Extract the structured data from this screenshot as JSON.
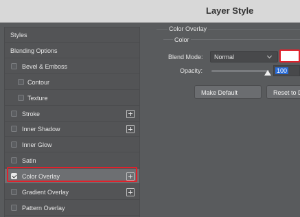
{
  "window": {
    "title": "Layer Style"
  },
  "sidebar": {
    "items": [
      {
        "label": "Styles",
        "checkbox": false,
        "plus": false,
        "checked": false
      },
      {
        "label": "Blending Options",
        "checkbox": false,
        "plus": false,
        "checked": false
      },
      {
        "label": "Bevel & Emboss",
        "checkbox": true,
        "plus": false,
        "checked": false
      },
      {
        "label": "Contour",
        "checkbox": true,
        "plus": false,
        "checked": false
      },
      {
        "label": "Texture",
        "checkbox": true,
        "plus": false,
        "checked": false
      },
      {
        "label": "Stroke",
        "checkbox": true,
        "plus": true,
        "checked": false
      },
      {
        "label": "Inner Shadow",
        "checkbox": true,
        "plus": true,
        "checked": false
      },
      {
        "label": "Inner Glow",
        "checkbox": true,
        "plus": false,
        "checked": false
      },
      {
        "label": "Satin",
        "checkbox": true,
        "plus": false,
        "checked": false
      },
      {
        "label": "Color Overlay",
        "checkbox": true,
        "plus": true,
        "checked": true,
        "selected": true
      },
      {
        "label": "Gradient Overlay",
        "checkbox": true,
        "plus": true,
        "checked": false
      },
      {
        "label": "Pattern Overlay",
        "checkbox": true,
        "plus": false,
        "checked": false
      }
    ]
  },
  "panel": {
    "group_title": "Color Overlay",
    "sub_title": "Color",
    "blend_mode_label": "Blend Mode:",
    "blend_mode_value": "Normal",
    "overlay_color": "#ffffff",
    "opacity_label": "Opacity:",
    "opacity_value": "100",
    "opacity_percent": 100,
    "make_default_label": "Make Default",
    "reset_label": "Reset to Default"
  },
  "colors": {
    "highlight": "#e0212b",
    "selection": "#2a6cd6"
  }
}
